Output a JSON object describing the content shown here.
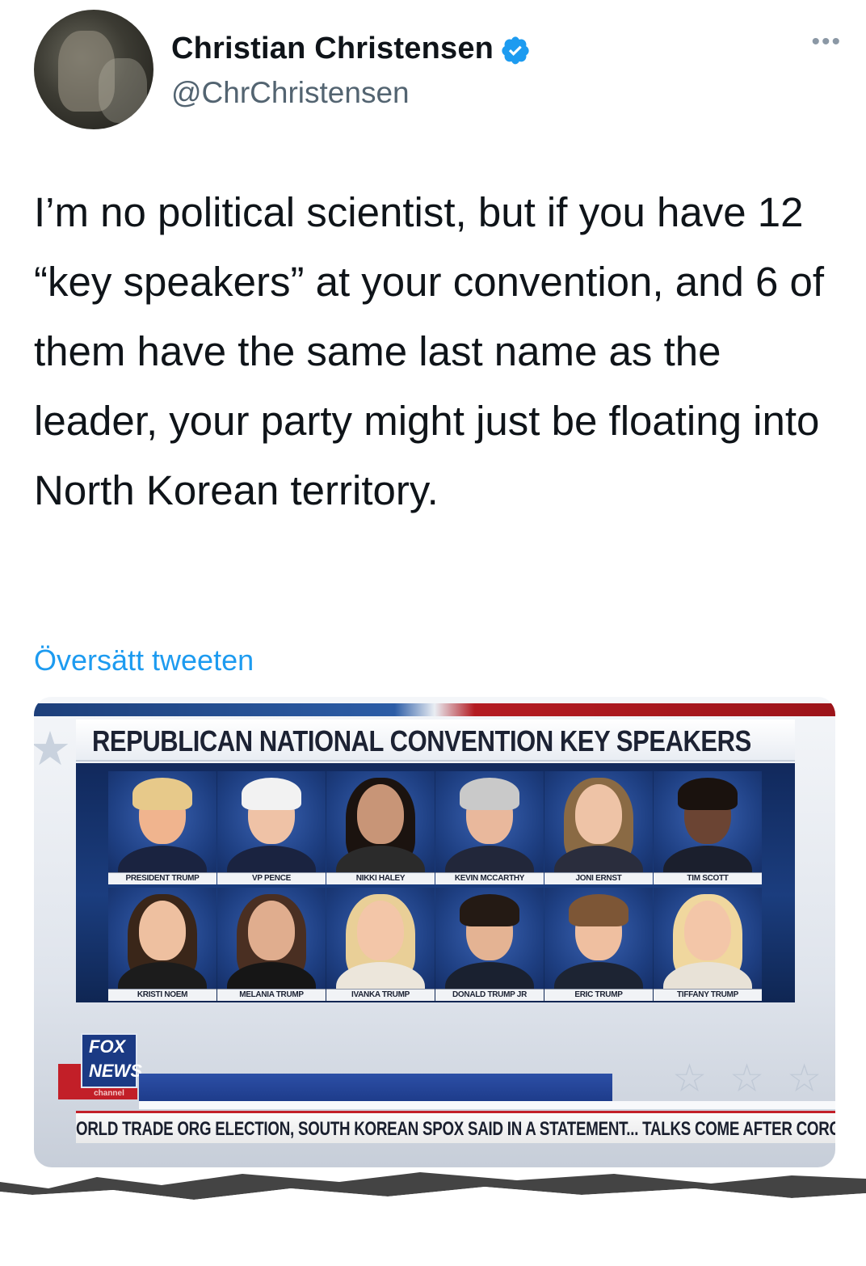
{
  "tweet": {
    "display_name": "Christian Christensen",
    "handle": "@ChrChristensen",
    "verified": true,
    "more_icon": "more-dots-icon",
    "text": "I’m no political scientist, but if you have 12 “key speakers” at your convention, and 6 of them have the same last name as the leader, your party might just be floating into North Korean territory.",
    "translate_link": "Översätt tweeten"
  },
  "media": {
    "banner_title": "REPUBLICAN NATIONAL CONVENTION KEY SPEAKERS",
    "speakers": [
      {
        "label": "PRESIDENT TRUMP"
      },
      {
        "label": "VP PENCE"
      },
      {
        "label": "NIKKI HALEY"
      },
      {
        "label": "KEVIN MCCARTHY"
      },
      {
        "label": "JONI ERNST"
      },
      {
        "label": "TIM SCOTT"
      },
      {
        "label": "KRISTI NOEM"
      },
      {
        "label": "MELANIA TRUMP"
      },
      {
        "label": "IVANKA TRUMP"
      },
      {
        "label": "DONALD TRUMP JR"
      },
      {
        "label": "ERIC TRUMP"
      },
      {
        "label": "TIFFANY TRUMP"
      }
    ],
    "logo": {
      "line1": "FOX",
      "line2": "NEWS",
      "line3": "channel"
    },
    "ticker": "ORLD TRADE ORG ELECTION, SOUTH KOREAN SPOX SAID IN A STATEMENT...   TALKS COME AFTER CORON",
    "colors": {
      "navy": "#1b3a84",
      "red": "#c21f28",
      "link": "#1d9bf0"
    }
  }
}
